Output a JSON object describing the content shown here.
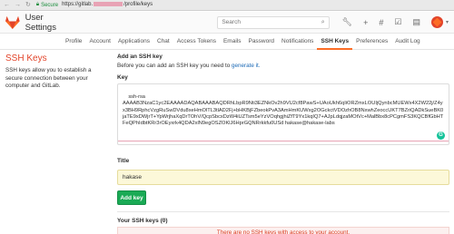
{
  "browser": {
    "secure_label": "Secure",
    "url_prefix": "https://gitlab.",
    "url_suffix": "/profile/keys",
    "icons": [
      "back-icon",
      "forward-icon",
      "reload-icon",
      "star-icon",
      "menu-icon"
    ]
  },
  "header": {
    "title": "User Settings",
    "search_placeholder": "Search",
    "icons": [
      "wrench-icon",
      "plus-icon",
      "hash-icon",
      "checklist-icon",
      "document-icon",
      "avatar-icon"
    ],
    "colors": {
      "brand_orange": "#fc6d26",
      "brand_red": "#e24329"
    }
  },
  "tabs": [
    {
      "label": "Profile",
      "active": false
    },
    {
      "label": "Account",
      "active": false
    },
    {
      "label": "Applications",
      "active": false
    },
    {
      "label": "Chat",
      "active": false
    },
    {
      "label": "Access Tokens",
      "active": false
    },
    {
      "label": "Emails",
      "active": false
    },
    {
      "label": "Password",
      "active": false
    },
    {
      "label": "Notifications",
      "active": false
    },
    {
      "label": "SSH Keys",
      "active": true
    },
    {
      "label": "Preferences",
      "active": false
    },
    {
      "label": "Audit Log",
      "active": false
    }
  ],
  "sidebar": {
    "heading": "SSH Keys",
    "description": "SSH keys allow you to establish a secure connection between your computer and GitLab."
  },
  "form": {
    "section_title": "Add an SSH key",
    "intro_text": "Before you can add an SSH key you need to ",
    "intro_link": "generate it.",
    "key_label": "Key",
    "key_value": "ssh-rsa\nAAAAB3NzaC1yc2EAAAADAQABAAABAQDRhLbpR9Nti3EZNkOv2h9VU2cf8PawS+UAoUkh6qIiORZmxLOUIjQynbcMUEWx4X2W22j/Z4yx3BH9RphcVzgRuSwDVdu8xeHmOlTL3tlAD2Fj+bHKBjFZbeokPvA3AmHmKUWxg2OGckctVDOzhOB8NxwhZeoccUKT7BZriQADkSueBK0jaTE9xDWjrT+YpWrjhaXqDrTOhV/QcpSbcxDzW4iUZTsm5eYzVOqhgjhiZfT9Yx1kqIQ7+AJpLdqjzaMOtVc+MalBbx8cPCgmFS3KQCBfGbHTFeQPhIdbtKRr3rOEyxrk4QDA2xlN9egOSZOKlJ6HprGQNRrkkfu0USd hakase@hakase-labs",
    "title_label": "Title",
    "title_value": "hakase",
    "submit_label": "Add key"
  },
  "keys_list": {
    "heading": "Your SSH keys (0)",
    "empty_message": "There are no SSH keys with access to your account."
  }
}
